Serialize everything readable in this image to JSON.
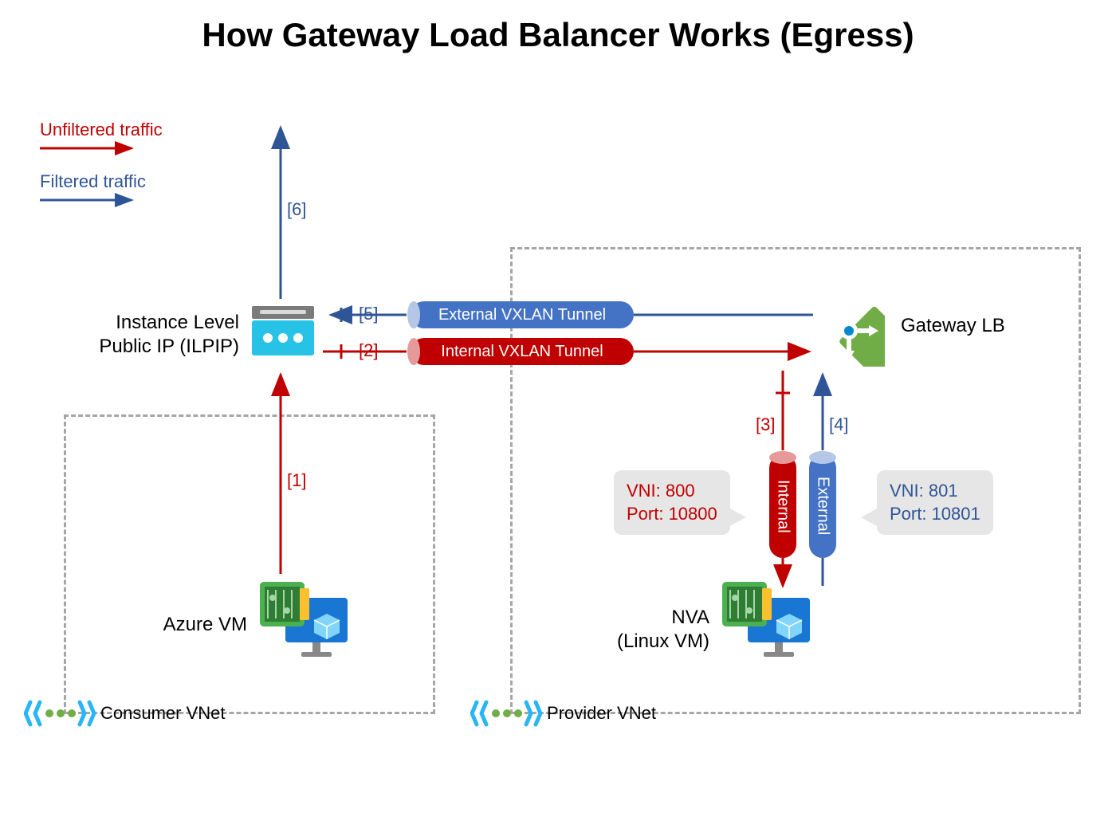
{
  "title": "How Gateway Load Balancer Works (Egress)",
  "legend": {
    "unfiltered": "Unfiltered traffic",
    "filtered": "Filtered traffic"
  },
  "nodes": {
    "ilpip": "Instance Level\nPublic IP (ILPIP)",
    "azure_vm": "Azure VM",
    "nva": "NVA\n(Linux VM)",
    "gateway_lb": "Gateway LB"
  },
  "vnets": {
    "consumer": "Consumer VNet",
    "provider": "Provider VNet"
  },
  "tunnels": {
    "external": "External VXLAN Tunnel",
    "internal": "Internal VXLAN Tunnel",
    "internal_short": "Internal",
    "external_short": "External"
  },
  "callouts": {
    "internal": {
      "vni": "VNI: 800",
      "port": "Port: 10800"
    },
    "external": {
      "vni": "VNI: 801",
      "port": "Port: 10801"
    }
  },
  "steps": {
    "s1": "[1]",
    "s2": "[2]",
    "s3": "[3]",
    "s4": "[4]",
    "s5": "[5]",
    "s6": "[6]"
  },
  "colors": {
    "red": "#C00000",
    "blue": "#2F5597",
    "tunnel_blue": "#4472C4",
    "green": "#70AD47",
    "cyan": "#29B6F6"
  }
}
